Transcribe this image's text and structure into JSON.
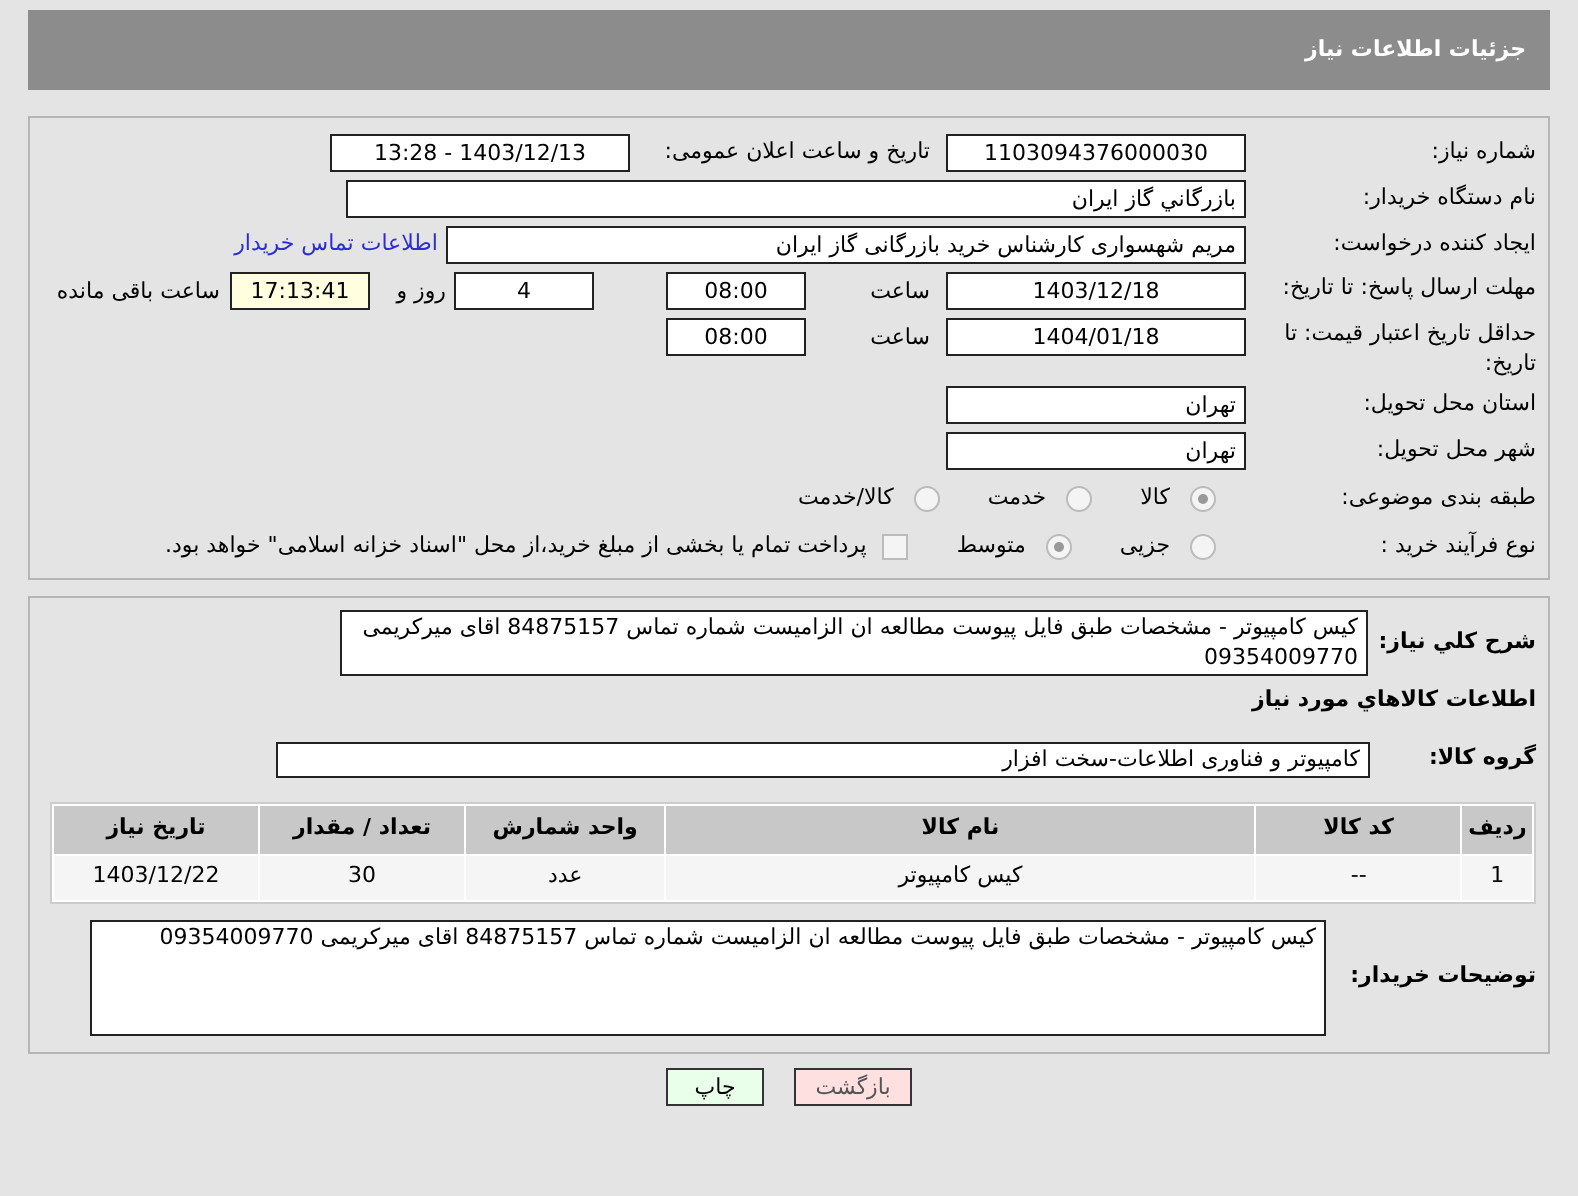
{
  "header": {
    "title": "جزئیات اطلاعات نیاز"
  },
  "need_number": {
    "label": "شماره نیاز:",
    "value": "1103094376000030"
  },
  "announce": {
    "label": "تاریخ و ساعت اعلان عمومی:",
    "value": "1403/12/13 - 13:28"
  },
  "buyer_org": {
    "label": "نام دستگاه خریدار:",
    "value": "بازرگاني گاز ايران"
  },
  "creator": {
    "label": "ایجاد کننده درخواست:",
    "value": "مریم شهسواری کارشناس خرید بازرگانی گاز ایران",
    "link": "اطلاعات تماس خریدار"
  },
  "deadline": {
    "label": "مهلت ارسال پاسخ: تا تاریخ:",
    "date": "1403/12/18",
    "time_label": "ساعت",
    "time": "08:00",
    "days": "4",
    "days_label": "روز و",
    "remaining": "17:13:41",
    "remaining_label": "ساعت باقی مانده"
  },
  "validity": {
    "label": "حداقل تاریخ اعتبار قیمت: تا تاریخ:",
    "date": "1404/01/18",
    "time_label": "ساعت",
    "time": "08:00"
  },
  "province": {
    "label": "استان محل تحویل:",
    "value": "تهران"
  },
  "city": {
    "label": "شهر محل تحویل:",
    "value": "تهران"
  },
  "category": {
    "label": "طبقه بندی موضوعی:",
    "options": [
      {
        "label": "کالا",
        "selected": true
      },
      {
        "label": "خدمت",
        "selected": false
      },
      {
        "label": "کالا/خدمت",
        "selected": false
      }
    ]
  },
  "process": {
    "label": "نوع فرآیند خرید :",
    "options": [
      {
        "label": "جزیی",
        "selected": false
      },
      {
        "label": "متوسط",
        "selected": true
      }
    ],
    "payment": {
      "label": "پرداخت تمام یا بخشی از مبلغ خرید،از محل \"اسناد خزانه اسلامی\" خواهد بود.",
      "checked": false
    }
  },
  "summary": {
    "label": "شرح کلي نياز:",
    "text": "کیس کامپیوتر   - مشخصات طبق فایل پیوست مطالعه ان الزامیست شماره تماس 84875157 اقای میرکریمی 09354009770"
  },
  "goods_title": "اطلاعات کالاهاي مورد نياز",
  "group": {
    "label": "گروه کالا:",
    "value": "کامپیوتر و فناوری اطلاعات-سخت افزار"
  },
  "table": {
    "columns": [
      "ردیف",
      "کد کالا",
      "نام کالا",
      "واحد شمارش",
      "تعداد / مقدار",
      "تاریخ نیاز"
    ],
    "rows": [
      [
        "1",
        "--",
        "کیس کامپیوتر",
        "عدد",
        "30",
        "1403/12/22"
      ]
    ]
  },
  "buyer_notes": {
    "label": "توضیحات خریدار:",
    "text": "کیس کامپیوتر   - مشخصات طبق فایل پیوست مطالعه ان الزامیست شماره تماس 84875157 اقای میرکریمی 09354009770"
  },
  "buttons": [
    {
      "label": "بازگشت",
      "kind": "back"
    },
    {
      "label": "چاپ",
      "kind": "print"
    }
  ]
}
